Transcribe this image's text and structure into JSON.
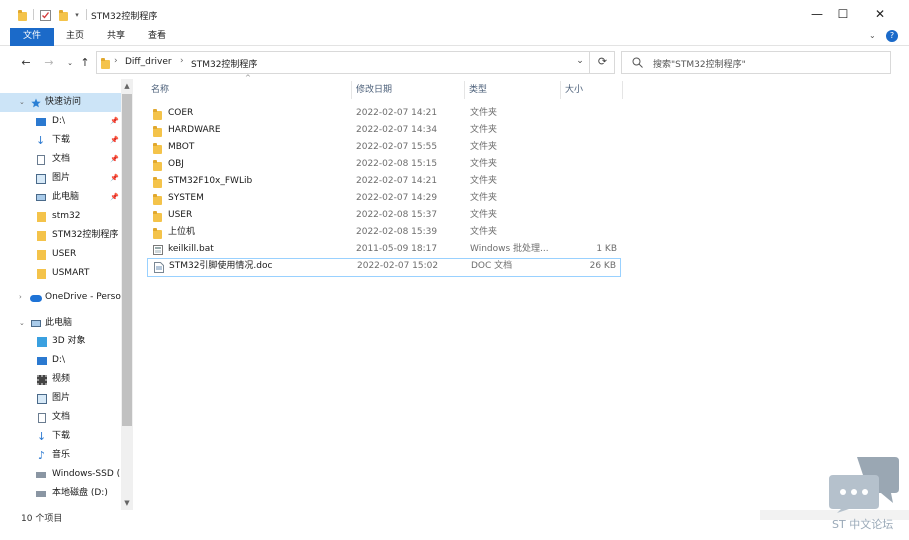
{
  "window": {
    "title": "STM32控制程序",
    "buttons": {
      "minimize": "—",
      "maximize": "☐",
      "close": "✕"
    }
  },
  "ribbon": {
    "tabs": [
      "文件",
      "主页",
      "共享",
      "查看"
    ]
  },
  "address": {
    "crumbs": [
      "Diff_driver",
      "STM32控制程序"
    ],
    "search_placeholder": "搜索\"STM32控制程序\""
  },
  "sidebar": {
    "quick_access": "快速访问",
    "pinned": [
      {
        "label": "D:\\",
        "icon": "drive-icon"
      },
      {
        "label": "下载",
        "icon": "download-icon"
      },
      {
        "label": "文档",
        "icon": "document-icon"
      },
      {
        "label": "图片",
        "icon": "picture-icon"
      },
      {
        "label": "此电脑",
        "icon": "computer-icon"
      }
    ],
    "recent": [
      "stm32",
      "STM32控制程序",
      "USER",
      "USMART"
    ],
    "onedrive": "OneDrive - Perso",
    "this_pc": "此电脑",
    "pc_items": [
      {
        "label": "3D 对象",
        "icon": "cube-icon"
      },
      {
        "label": "D:\\",
        "icon": "drive-icon"
      },
      {
        "label": "视频",
        "icon": "video-icon"
      },
      {
        "label": "图片",
        "icon": "picture-icon"
      },
      {
        "label": "文档",
        "icon": "document-icon"
      },
      {
        "label": "下载",
        "icon": "download-icon"
      },
      {
        "label": "音乐",
        "icon": "music-icon"
      },
      {
        "label": "Windows-SSD (",
        "icon": "disk-icon"
      },
      {
        "label": "本地磁盘 (D:)",
        "icon": "disk-icon"
      }
    ]
  },
  "columns": {
    "name": "名称",
    "date": "修改日期",
    "type": "类型",
    "size": "大小"
  },
  "files": [
    {
      "name": "COER",
      "date": "2022-02-07 14:21",
      "type": "文件夹",
      "size": "",
      "icon": "folder-icon"
    },
    {
      "name": "HARDWARE",
      "date": "2022-02-07 14:34",
      "type": "文件夹",
      "size": "",
      "icon": "folder-icon"
    },
    {
      "name": "MBOT",
      "date": "2022-02-07 15:55",
      "type": "文件夹",
      "size": "",
      "icon": "folder-icon"
    },
    {
      "name": "OBJ",
      "date": "2022-02-08 15:15",
      "type": "文件夹",
      "size": "",
      "icon": "folder-icon"
    },
    {
      "name": "STM32F10x_FWLib",
      "date": "2022-02-07 14:21",
      "type": "文件夹",
      "size": "",
      "icon": "folder-icon"
    },
    {
      "name": "SYSTEM",
      "date": "2022-02-07 14:29",
      "type": "文件夹",
      "size": "",
      "icon": "folder-icon"
    },
    {
      "name": "USER",
      "date": "2022-02-08 15:37",
      "type": "文件夹",
      "size": "",
      "icon": "folder-icon"
    },
    {
      "name": "上位机",
      "date": "2022-02-08 15:39",
      "type": "文件夹",
      "size": "",
      "icon": "folder-icon"
    },
    {
      "name": "keilkill.bat",
      "date": "2011-05-09 18:17",
      "type": "Windows 批处理...",
      "size": "1 KB",
      "icon": "batch-file-icon"
    },
    {
      "name": "STM32引脚使用情况.doc",
      "date": "2022-02-07 15:02",
      "type": "DOC 文档",
      "size": "26 KB",
      "icon": "doc-file-icon"
    }
  ],
  "status": {
    "item_count": "10 个项目"
  },
  "watermark": {
    "text": "ST 中文论坛"
  },
  "colors": {
    "accent": "#1b6ac9",
    "selection": "#cce4f7",
    "folder": "#f4c34a"
  }
}
